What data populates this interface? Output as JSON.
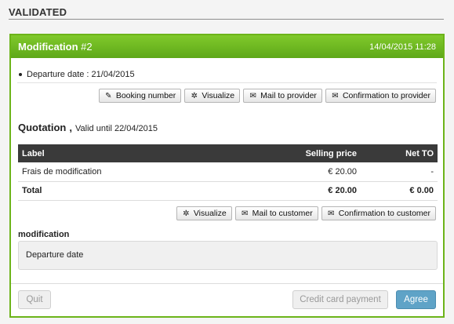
{
  "section": {
    "title": "VALIDATED"
  },
  "panel": {
    "title": "Modification",
    "number": "#2",
    "datetime": "14/04/2015 11:28",
    "detail": "Departure date : 21/04/2015",
    "top_buttons": [
      {
        "label": "Booking number",
        "icon": "pencil-icon"
      },
      {
        "label": "Visualize",
        "icon": "gear-icon"
      },
      {
        "label": "Mail to provider",
        "icon": "envelope-icon"
      },
      {
        "label": "Confirmation to provider",
        "icon": "envelope-icon"
      }
    ],
    "quotation": {
      "title": "Quotation",
      "comma": ",",
      "valid": "Valid until 22/04/2015"
    },
    "table": {
      "headers": [
        "Label",
        "Selling price",
        "Net TO"
      ],
      "rows": [
        [
          "Frais de modification",
          "€ 20.00",
          "-"
        ]
      ],
      "total": [
        "Total",
        "€ 20.00",
        "€ 0.00"
      ]
    },
    "mid_buttons": [
      {
        "label": "Visualize",
        "icon": "gear-icon"
      },
      {
        "label": "Mail to customer",
        "icon": "envelope-icon"
      },
      {
        "label": "Confirmation to customer",
        "icon": "envelope-icon"
      }
    ],
    "note": {
      "label": "modification",
      "text": "Departure date"
    },
    "footer": {
      "quit": "Quit",
      "credit_card": "Credit card payment",
      "agree": "Agree"
    }
  },
  "colors": {
    "header_green": "#6cb41a",
    "table_header": "#3a3a3a",
    "agree_blue": "#5fa3c7"
  }
}
